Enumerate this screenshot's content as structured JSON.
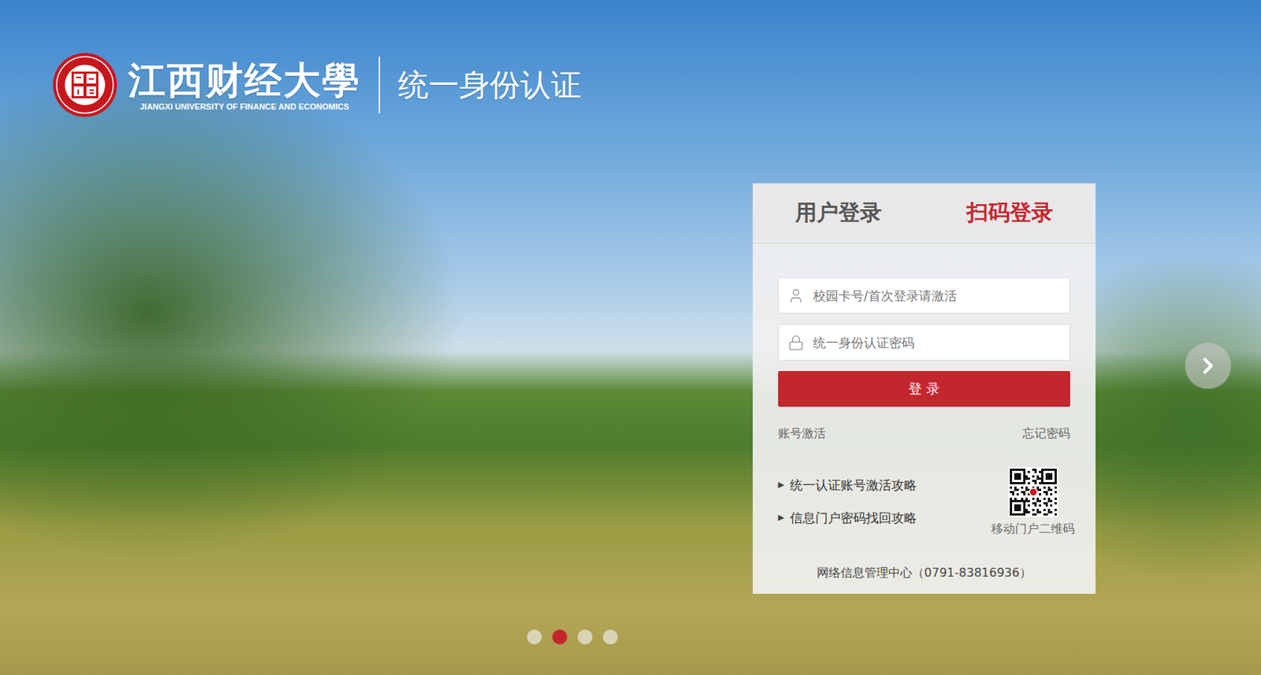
{
  "header": {
    "logo_name": "江西财经大學",
    "logo_subtitle": "JIANGXI UNIVERSITY OF FINANCE AND ECONOMICS",
    "title": "统一身份认证"
  },
  "login": {
    "tabs": [
      {
        "label": "用户登录",
        "selected": false
      },
      {
        "label": "扫码登录",
        "selected": true
      }
    ],
    "fields": [
      {
        "placeholder": "校园卡号/首次登录请激活",
        "kind": "user"
      },
      {
        "placeholder": "统一身份认证密码",
        "kind": "password"
      }
    ],
    "submit": "登 录",
    "links": [
      "账号激活",
      "忘记密码"
    ],
    "guides": [
      {
        "marker": "▶",
        "label": "统一认证账号激活攻略"
      },
      {
        "marker": "▶",
        "label": "信息门户密码找回攻略"
      }
    ],
    "qr_caption": "移动门户二维码",
    "footer": "网络信息管理中心（0791-83816936）"
  },
  "carousel": {
    "slides": [
      {
        "selected": false
      },
      {
        "selected": true
      },
      {
        "selected": false
      },
      {
        "selected": false
      }
    ]
  }
}
